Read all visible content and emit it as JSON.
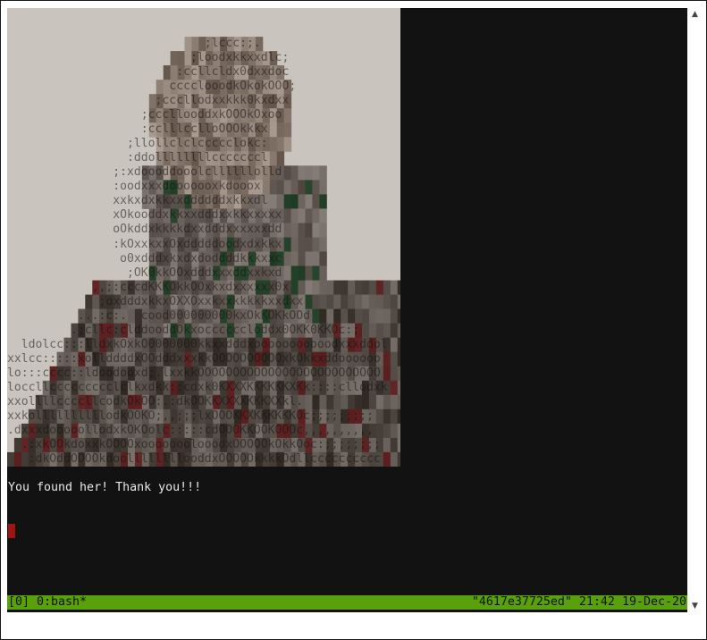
{
  "terminal": {
    "ascii_art_lines": [
      "                                            ",
      "                                            ",
      "                            ;lccc:;.        ",
      "                          ;loodxkkxxdlc;    ",
      "                        :ccllcldx0dxxdoc    ",
      "                       cccclooodkOkokOOO;   ",
      "                     ;cccllodxxkkk0kxdxx    ",
      "                   ;cccllooddxkOOOkOxoo     ",
      "                   :cclllcclloOOOkkkx       ",
      "                 ;llollclclccccclokc:       ",
      "                 :ddollllllllcccccccl       ",
      "               ;:xdoooddooolcllllllolld     ",
      "               :oodxxxdooooooxkdooox        ",
      "               xxkxdxkkxxddddddxkkxdl       ",
      "               xOkooddxkkxxdddxxkkxxxxx     ",
      "               oOkddxkkkkdxxdddxxxxxxdd     ",
      "               :kOxxkxxOxdddddoodxdxkkx     ",
      "                o0xdddxkxdxdoddddkkkxxc     ",
      "                 ;OK0kkOOxdddxxxddxxkxd     ",
      "            ,,;:cccdKKKOkkOOxkxdxxxxxx0x    ",
      "             ;oxdddxkkxOXXOxxkxxkkkkkxxdxx ",
      "          ...:c:.  cood000000000kxOkKOKkOOd ",
      "         .;cllc:clddooddOkxoccccccloddx0OKK0KKOc:;",
      "  ldolcc:::lldxkOxkO0000000kkxxdddxooooooooooodxxxddol",
      "xxlcc:::::xollddddxOOdddxxxkkOOOOOOOOOOxkOkkxddoooooo",
      "lo:::cccc::ldoodooxd;.lxxkkOOOOOOOOOOOOOOOOOOOOOOOOOO",
      "loccllccccccccclclkxdkk::cdxk0KXXXKKKKKKXKk::::cllodxk",
      "xxollllccccllcodkOkOO:.:dkOOKKXXXXKKKXXkl.",
      "xxkollllllllllodkOOKO;,,;;;lxOOOKKXKKKKKKOc;;;;;;;;;",
      ".dxxxdooooollodxkOKOolc:::::cdOOOKKOOKOOOc,,,,,,,,,,",
      "  .:xkOOkdoxxkOOOOxooooooolooodxOOOOOkOkkOoc:;;;;;;;;",
      "   :dkOddOOOOkdoollllllllooddxOOOOOkkkkOdllcccccccccc"
    ],
    "message": "You found her! Thank you!!!",
    "statusbar": {
      "left": "[0] 0:bash*",
      "right": "\"4617e37725ed\" 21:42 19-Dec-20"
    }
  },
  "colors": {
    "terminal_bg": "#121212",
    "statusbar_bg": "#5aa00c",
    "cursor": "#a01414",
    "text": "#e8e8e8"
  }
}
